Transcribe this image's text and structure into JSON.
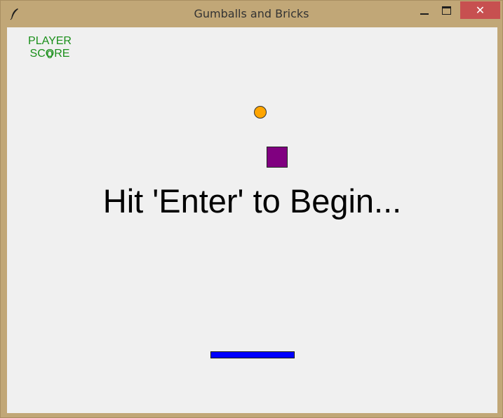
{
  "window": {
    "title": "Gumballs and Bricks",
    "close_glyph": "✕",
    "colors": {
      "frame": "#c1a777",
      "close_button": "#c75050",
      "canvas_background": "#f0f0f0"
    }
  },
  "hud": {
    "score_label": "PLAYER SCORE",
    "score_value": "0",
    "color": "#1a8f1a"
  },
  "game": {
    "message": "Hit 'Enter' to Begin...",
    "ball_color": "#ffa500",
    "brick_color": "#800080",
    "paddle_color": "#0000ff"
  },
  "icons": {
    "app": "feather-icon",
    "minimize": "minimize-icon",
    "maximize": "maximize-icon",
    "close": "close-icon"
  }
}
